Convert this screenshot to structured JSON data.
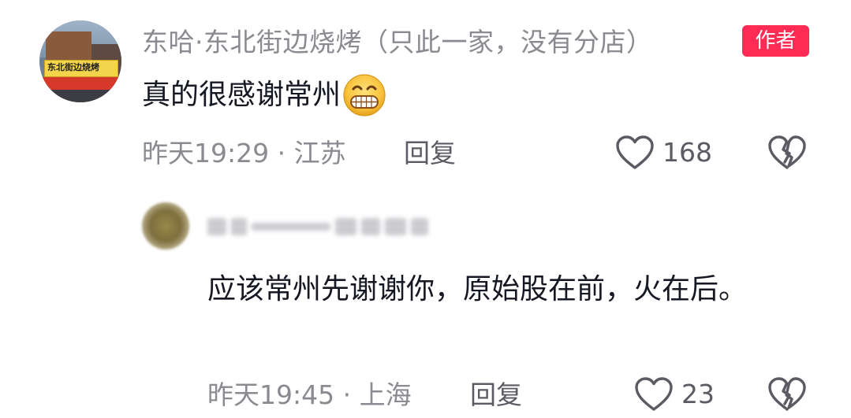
{
  "comment": {
    "username": "东哈·东北街边烧烤（只此一家，没有分店）",
    "author_badge": "作者",
    "text": "真的很感谢常州",
    "emoji": "grinning-face-emoji",
    "avatar_sign": "东北街边烧烤",
    "time": "昨天19:29",
    "separator": " · ",
    "location": "江苏",
    "reply_label": "回复",
    "like_count": "168",
    "icons": {
      "like": "heart-outline-icon",
      "dislike": "broken-heart-icon"
    }
  },
  "reply": {
    "text": "应该常州先谢谢你，原始股在前，火在后。",
    "time": "昨天19:45",
    "separator": " · ",
    "location": "上海",
    "reply_label": "回复",
    "like_count": "23",
    "icons": {
      "like": "heart-outline-icon",
      "dislike": "broken-heart-icon"
    }
  },
  "colors": {
    "badge": "#fe2c55",
    "secondary_text": "#8a8b91",
    "primary_text": "#161823"
  }
}
